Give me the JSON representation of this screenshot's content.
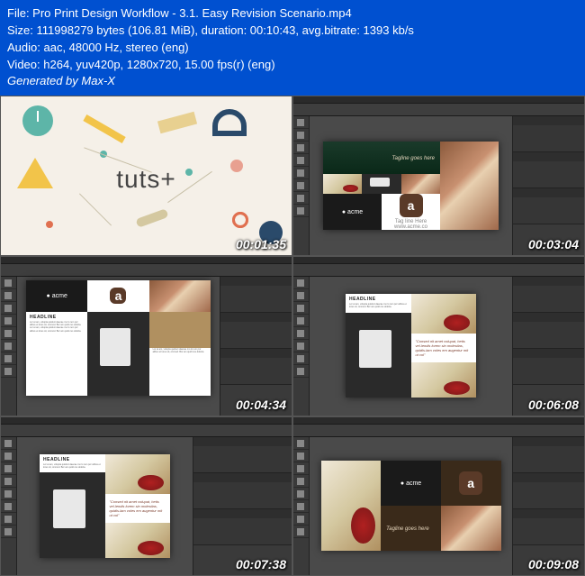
{
  "metadata": {
    "file_label": "File: ",
    "file_value": "Pro Print Design Workflow - 3.1. Easy Revision Scenario.mp4",
    "size_label": "Size: ",
    "size_value": "111998279 bytes (106.81 MiB), duration: 00:10:43, avg.bitrate: 1393 kb/s",
    "audio_label": "Audio: ",
    "audio_value": "aac, 48000 Hz, stereo (eng)",
    "video_label": "Video: ",
    "video_value": "h264, yuv420p, 1280x720, 15.00 fps(r) (eng)",
    "generated": "Generated by Max-X"
  },
  "thumbnails": {
    "t1": {
      "timestamp": "00:01:35",
      "logo": "tuts+"
    },
    "t2": {
      "timestamp": "00:03:04",
      "brand": "acme",
      "tagline": "Tagline goes here"
    },
    "t3": {
      "timestamp": "00:04:34",
      "brand": "acme",
      "headline": "HEADLINE"
    },
    "t4": {
      "timestamp": "00:06:08",
      "headline": "HEADLINE",
      "quote": "\"Consed nit amet volupat, hetis vel-lendis lorem sin molestias, quidis-lam voles em augentur mit ut vol\""
    },
    "t5": {
      "timestamp": "00:07:38",
      "headline": "HEADLINE",
      "quote": "\"Consed nit amet volupat, hetis vel-lendis lorem sin molestias, quidis-lam voles em augentur mit ut vol\""
    },
    "t6": {
      "timestamp": "00:09:08",
      "brand": "acme",
      "tagline": "Tagline goes here"
    }
  },
  "acme_subtext": "Tag line Here\nwww.acme.co",
  "body_filler": "Lor at am, volupta quiduci daecae mo lo rem por alibus et lores sit, ommod. Bor am quidi cus doloria."
}
